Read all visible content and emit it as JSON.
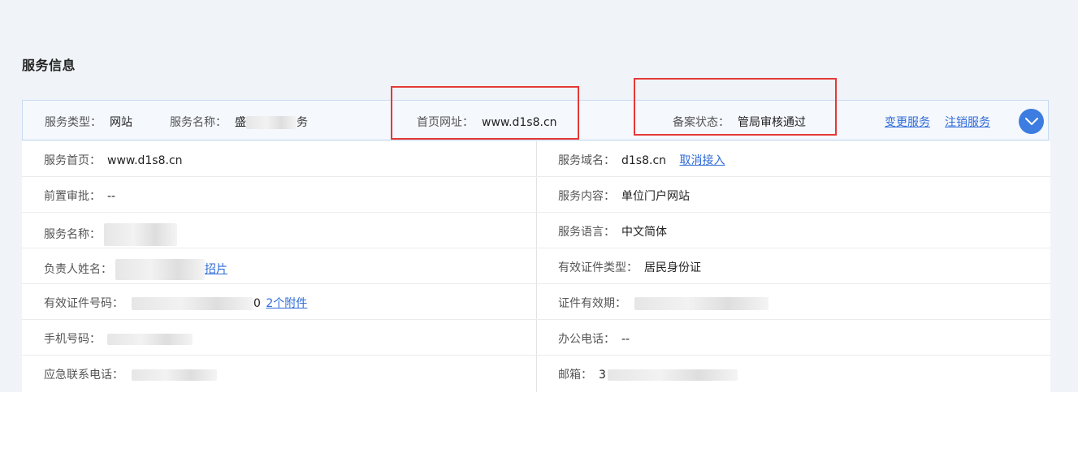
{
  "section_title": "服务信息",
  "header": {
    "service_type_label": "服务类型：",
    "service_type_value": "网站",
    "service_name_label": "服务名称：",
    "service_name_prefix": "盛",
    "service_name_suffix": "务",
    "homepage_label": "首页网址：",
    "homepage_value": "www.d1s8.cn",
    "status_label": "备案状态：",
    "status_value": "管局审核通过",
    "change_link": "变更服务",
    "cancel_link": "注销服务",
    "toggle_icon": "chevron-down-icon"
  },
  "details": {
    "rows": [
      {
        "left_label": "服务首页：",
        "left_value": "www.d1s8.cn",
        "right_label": "服务域名：",
        "right_value": "d1s8.cn",
        "right_link": "取消接入"
      },
      {
        "left_label": "前置审批：",
        "left_value": "--",
        "right_label": "服务内容：",
        "right_value": "单位门户网站"
      },
      {
        "left_label": "服务名称：",
        "left_value": "",
        "right_label": "服务语言：",
        "right_value": "中文简体"
      },
      {
        "left_label": "负责人姓名：",
        "left_value": "",
        "left_link_partial": "招片",
        "right_label": "有效证件类型：",
        "right_value": "居民身份证"
      },
      {
        "left_label": "有效证件号码：",
        "left_value_tail": "0",
        "left_link": "2个附件",
        "right_label": "证件有效期：",
        "right_value": ""
      },
      {
        "left_label": "手机号码：",
        "left_value": "",
        "right_label": "办公电话：",
        "right_value": "--"
      },
      {
        "left_label": "应急联系电话：",
        "left_value": "",
        "right_label": "邮箱：",
        "right_value_prefix": "3"
      }
    ]
  },
  "colors": {
    "accent": "#2f6bd8",
    "highlight_box": "#e53935",
    "header_bg": "#f5f8fd",
    "page_bg": "#f0f4f8"
  }
}
